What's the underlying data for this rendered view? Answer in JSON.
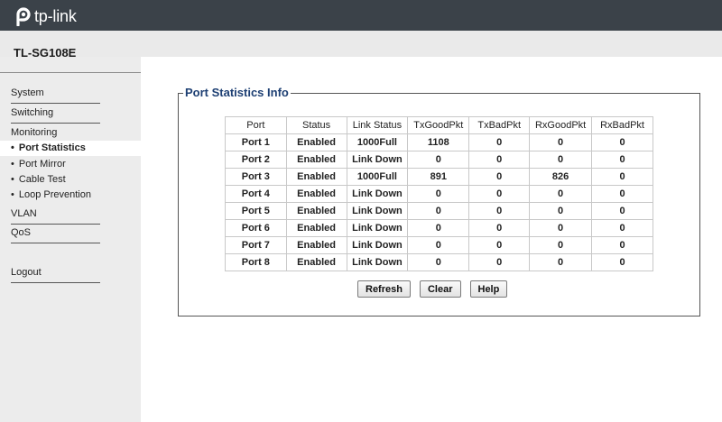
{
  "brand": {
    "logo_text": "tp-link",
    "accent": "#3b4249"
  },
  "model": "TL-SG108E",
  "sidebar": {
    "items": [
      {
        "label": "System",
        "type": "main"
      },
      {
        "label": "Switching",
        "type": "main"
      },
      {
        "label": "Monitoring",
        "type": "main"
      },
      {
        "label": "Port Statistics",
        "type": "sub",
        "active": true
      },
      {
        "label": "Port Mirror",
        "type": "sub"
      },
      {
        "label": "Cable Test",
        "type": "sub"
      },
      {
        "label": "Loop Prevention",
        "type": "sub"
      },
      {
        "label": "VLAN",
        "type": "main"
      },
      {
        "label": "QoS",
        "type": "main"
      },
      {
        "label": "Logout",
        "type": "main"
      }
    ],
    "bullet": "•"
  },
  "panel": {
    "title": "Port Statistics Info",
    "columns": [
      "Port",
      "Status",
      "Link Status",
      "TxGoodPkt",
      "TxBadPkt",
      "RxGoodPkt",
      "RxBadPkt"
    ],
    "rows": [
      [
        "Port 1",
        "Enabled",
        "1000Full",
        "1108",
        "0",
        "0",
        "0"
      ],
      [
        "Port 2",
        "Enabled",
        "Link Down",
        "0",
        "0",
        "0",
        "0"
      ],
      [
        "Port 3",
        "Enabled",
        "1000Full",
        "891",
        "0",
        "826",
        "0"
      ],
      [
        "Port 4",
        "Enabled",
        "Link Down",
        "0",
        "0",
        "0",
        "0"
      ],
      [
        "Port 5",
        "Enabled",
        "Link Down",
        "0",
        "0",
        "0",
        "0"
      ],
      [
        "Port 6",
        "Enabled",
        "Link Down",
        "0",
        "0",
        "0",
        "0"
      ],
      [
        "Port 7",
        "Enabled",
        "Link Down",
        "0",
        "0",
        "0",
        "0"
      ],
      [
        "Port 8",
        "Enabled",
        "Link Down",
        "0",
        "0",
        "0",
        "0"
      ]
    ],
    "buttons": {
      "refresh": "Refresh",
      "clear": "Clear",
      "help": "Help"
    }
  }
}
